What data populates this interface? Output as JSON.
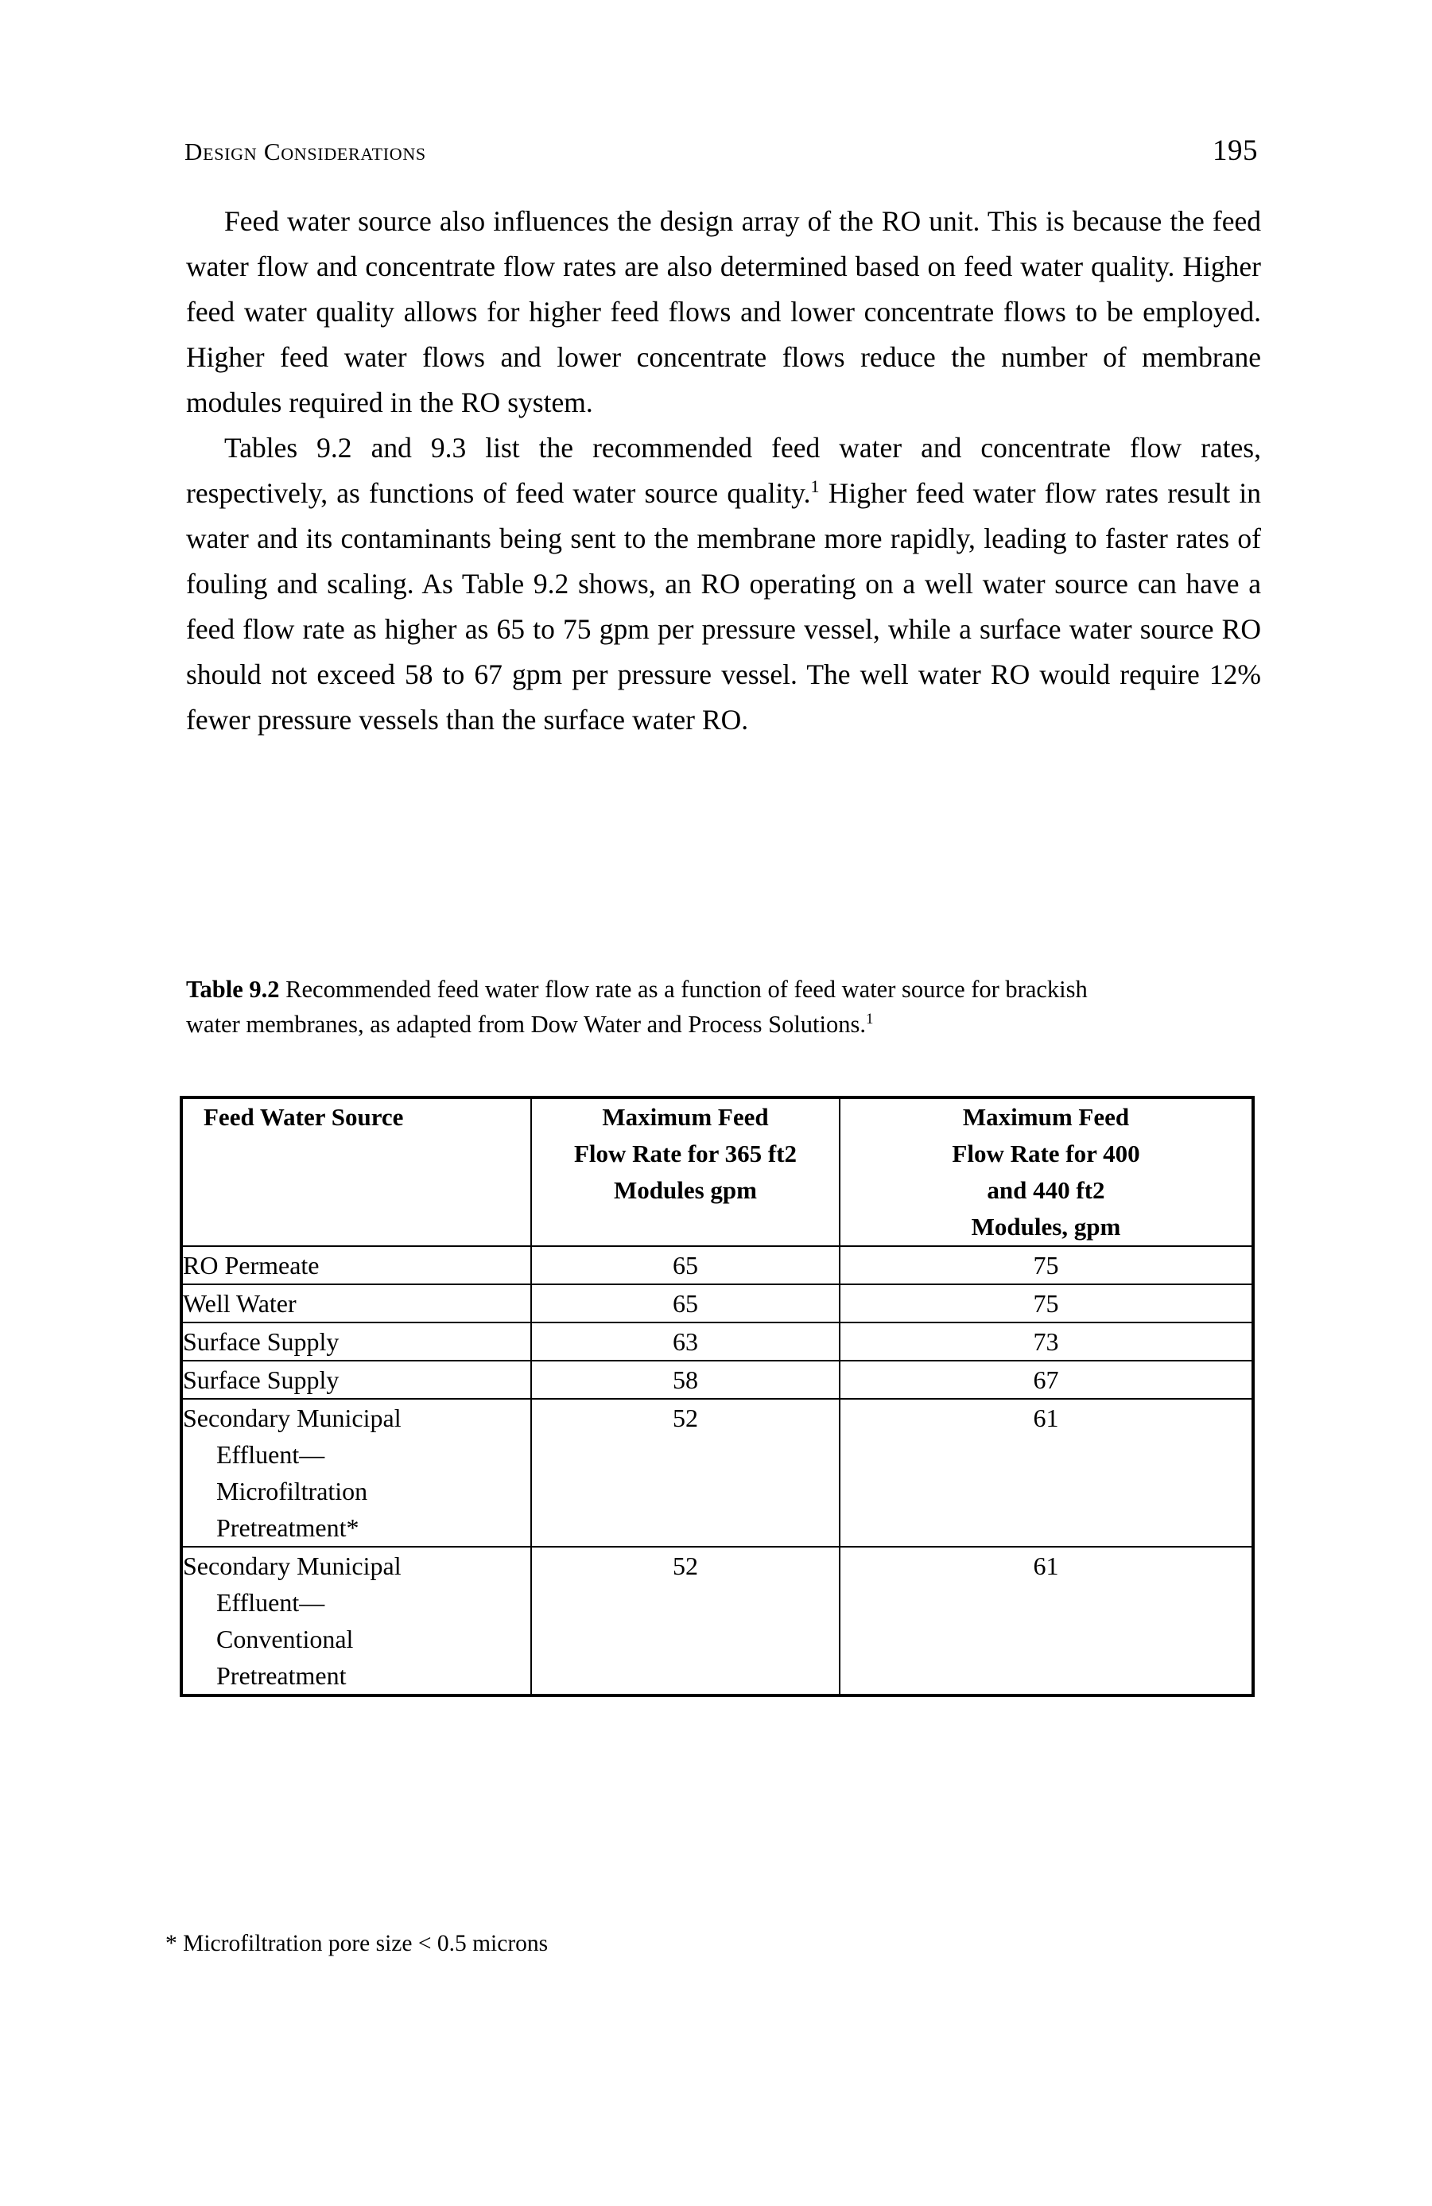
{
  "running_head": {
    "title": "Design Considerations",
    "page_number": "195"
  },
  "body": {
    "paragraph_1_part_1": "Feed water source also influences the design array of the RO unit. This is because the feed water flow and concentrate flow rates are also determined based on feed water quality. Higher feed water quality allows for higher feed flows and lower concentrate flows to be employed. Higher feed water flows and lower concentrate flows reduce the number of membrane modules required in the RO system.",
    "paragraph_2_part_1": "Tables 9.2 and 9.3 list the recommended feed water and concentrate flow rates, respectively, as functions of feed water source quality.",
    "paragraph_2_footnote_marker": "1",
    "paragraph_2_part_2": " Higher feed water flow rates result in water and its contaminants being sent to the membrane more rapidly, leading to faster rates of fouling and scaling. As Table 9.2 shows, an RO operating on a well water source can have a feed flow rate as higher as 65 to 75 gpm per pressure vessel, while a surface water source RO should not exceed 58 to 67 gpm per pressure vessel. The well water RO would require 12% fewer pressure vessels than the surface water RO."
  },
  "table_caption": {
    "label": "Table 9.2",
    "text": "  Recommended feed water flow rate as a function of feed water source for brackish water membranes, as adapted from Dow Water and Process Solutions.",
    "footnote_marker": "1"
  },
  "table": {
    "headers": [
      "Feed Water Source",
      [
        "Maximum Feed",
        "Flow Rate for 365 ft2",
        "Modules gpm"
      ],
      [
        "Maximum Feed",
        "Flow Rate for 400",
        "and 440 ft2",
        "Modules, gpm"
      ]
    ],
    "rows": [
      {
        "source_lines": [
          "RO Permeate"
        ],
        "max_flow_365": "65",
        "max_flow_400_440": "75"
      },
      {
        "source_lines": [
          "Well Water"
        ],
        "max_flow_365": "65",
        "max_flow_400_440": "75"
      },
      {
        "source_lines": [
          "Surface Supply"
        ],
        "max_flow_365": "63",
        "max_flow_400_440": "73"
      },
      {
        "source_lines": [
          "Surface Supply"
        ],
        "max_flow_365": "58",
        "max_flow_400_440": "67"
      },
      {
        "source_lines": [
          "Secondary Municipal",
          "Effluent—",
          "Microfiltration",
          "Pretreatment*"
        ],
        "max_flow_365": "52",
        "max_flow_400_440": "61"
      },
      {
        "source_lines": [
          "Secondary Municipal",
          "Effluent—",
          "Conventional",
          "Pretreatment"
        ],
        "max_flow_365": "52",
        "max_flow_400_440": "61"
      }
    ]
  },
  "footnote": {
    "text": "* Microfiltration pore size < 0.5 microns"
  }
}
